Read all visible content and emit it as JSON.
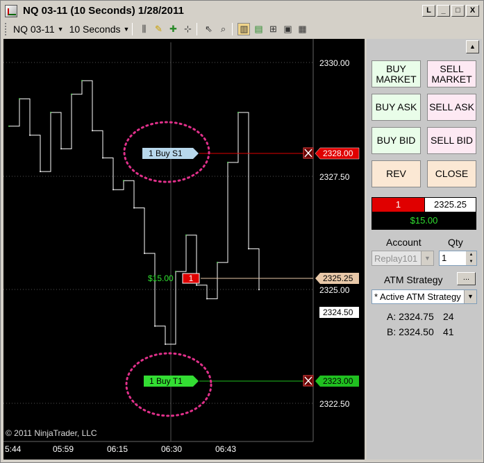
{
  "window": {
    "title": "NQ 03-11 (10 Seconds)  1/28/2011",
    "buttons": [
      "L",
      "_",
      "□",
      "X"
    ]
  },
  "toolbar": {
    "instrument": "NQ 03-11",
    "interval": "10 Seconds"
  },
  "chart": {
    "copyright": "© 2011 NinjaTrader, LLC",
    "price_axis": [
      "2330.00",
      "2327.50",
      "2325.00",
      "2322.50"
    ],
    "time_axis": [
      "5:44",
      "05:59",
      "06:15",
      "06:30",
      "06:43"
    ],
    "price_tags": {
      "stop": "2328.00",
      "entry": "2325.25",
      "last": "2324.50",
      "target": "2323.00"
    },
    "orders": {
      "stop_label": "1  Buy S1",
      "target_label": "1  Buy T1",
      "position_qty": "1",
      "pnl": "$15.00"
    },
    "colors": {
      "stop": "#e00000",
      "target": "#20c020",
      "entry": "#e8c8a8",
      "annotation": "#e0308a"
    }
  },
  "chart_data": {
    "type": "line",
    "title": "",
    "xlabel": "",
    "ylabel": "",
    "ylim": [
      2322.0,
      2330.5
    ],
    "x": [
      "5:44",
      "05:59",
      "06:15",
      "06:30",
      "06:43"
    ],
    "series": [
      {
        "values": [
          2328.6,
          2329.2,
          2328.4,
          2327.6,
          2328.9,
          2328.1,
          2329.3,
          2329.6,
          2328.5,
          2327.9,
          2327.2,
          2327.4,
          2326.8,
          2325.8,
          2324.2,
          2323.8,
          2325.4,
          2326.2,
          2325.1,
          2324.8,
          2325.6,
          2327.8,
          2328.9,
          2325.9,
          2325.0
        ]
      }
    ]
  },
  "panel": {
    "buy_market": "BUY MARKET",
    "sell_market": "SELL MARKET",
    "buy_ask": "BUY ASK",
    "sell_ask": "SELL ASK",
    "buy_bid": "BUY BID",
    "sell_bid": "SELL BID",
    "rev": "REV",
    "close": "CLOSE",
    "position_qty": "1",
    "position_price": "2325.25",
    "pnl": "$15.00",
    "account_label": "Account",
    "qty_label": "Qty",
    "account_value": "Replay101",
    "qty_value": "1",
    "atm_label": "ATM Strategy",
    "atm_more": "...",
    "atm_value": "* Active ATM Strategy",
    "ask_label": "A: 2324.75",
    "ask_size": "24",
    "bid_label": "B: 2324.50",
    "bid_size": "41"
  }
}
